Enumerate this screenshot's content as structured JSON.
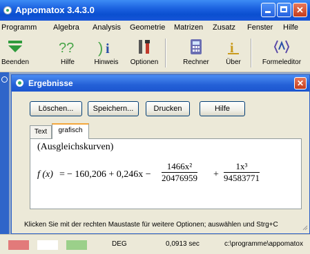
{
  "window": {
    "title": "Appomatox 3.4.3.0"
  },
  "menu": [
    "Programm",
    "Algebra",
    "Analysis",
    "Geometrie",
    "Matrizen",
    "Zusatz",
    "Fenster",
    "Hilfe"
  ],
  "toolbar": [
    {
      "label": "Beenden",
      "icon": "arrow-down-icon"
    },
    {
      "label": "Hilfe",
      "icon": "help-icon"
    },
    {
      "label": "Hinweis",
      "icon": "hint-icon"
    },
    {
      "label": "Optionen",
      "icon": "tools-icon"
    },
    {
      "label": "Rechner",
      "icon": "calculator-icon"
    },
    {
      "label": "Über",
      "icon": "info-icon"
    },
    {
      "label": "Formeleditor",
      "icon": "formula-editor-icon"
    }
  ],
  "child": {
    "title": "Ergebnisse",
    "buttons": [
      "Löschen...",
      "Speichern...",
      "Drucken",
      "Hilfe"
    ],
    "tabs": [
      "Text",
      "grafisch"
    ],
    "active_tab": "grafisch",
    "heading": "(Ausgleichskurven)",
    "formula": {
      "lhs": "f (x)",
      "eq": "=",
      "term1": "− 160,206 + 0,246x −",
      "frac1_num": "1466x²",
      "frac1_den": "20476959",
      "plus": "+",
      "frac2_num": "1x³",
      "frac2_den": "94583771"
    },
    "hint": "Klicken Sie mit der rechten Maustaste für weitere Optionen; auswählen und Strg+C"
  },
  "status": {
    "swatches": [
      "#e27a7a",
      "#ffffff",
      "#9bd08a"
    ],
    "mode": "DEG",
    "time": "0,0913 sec",
    "path": "c:\\programme\\appomatox"
  }
}
